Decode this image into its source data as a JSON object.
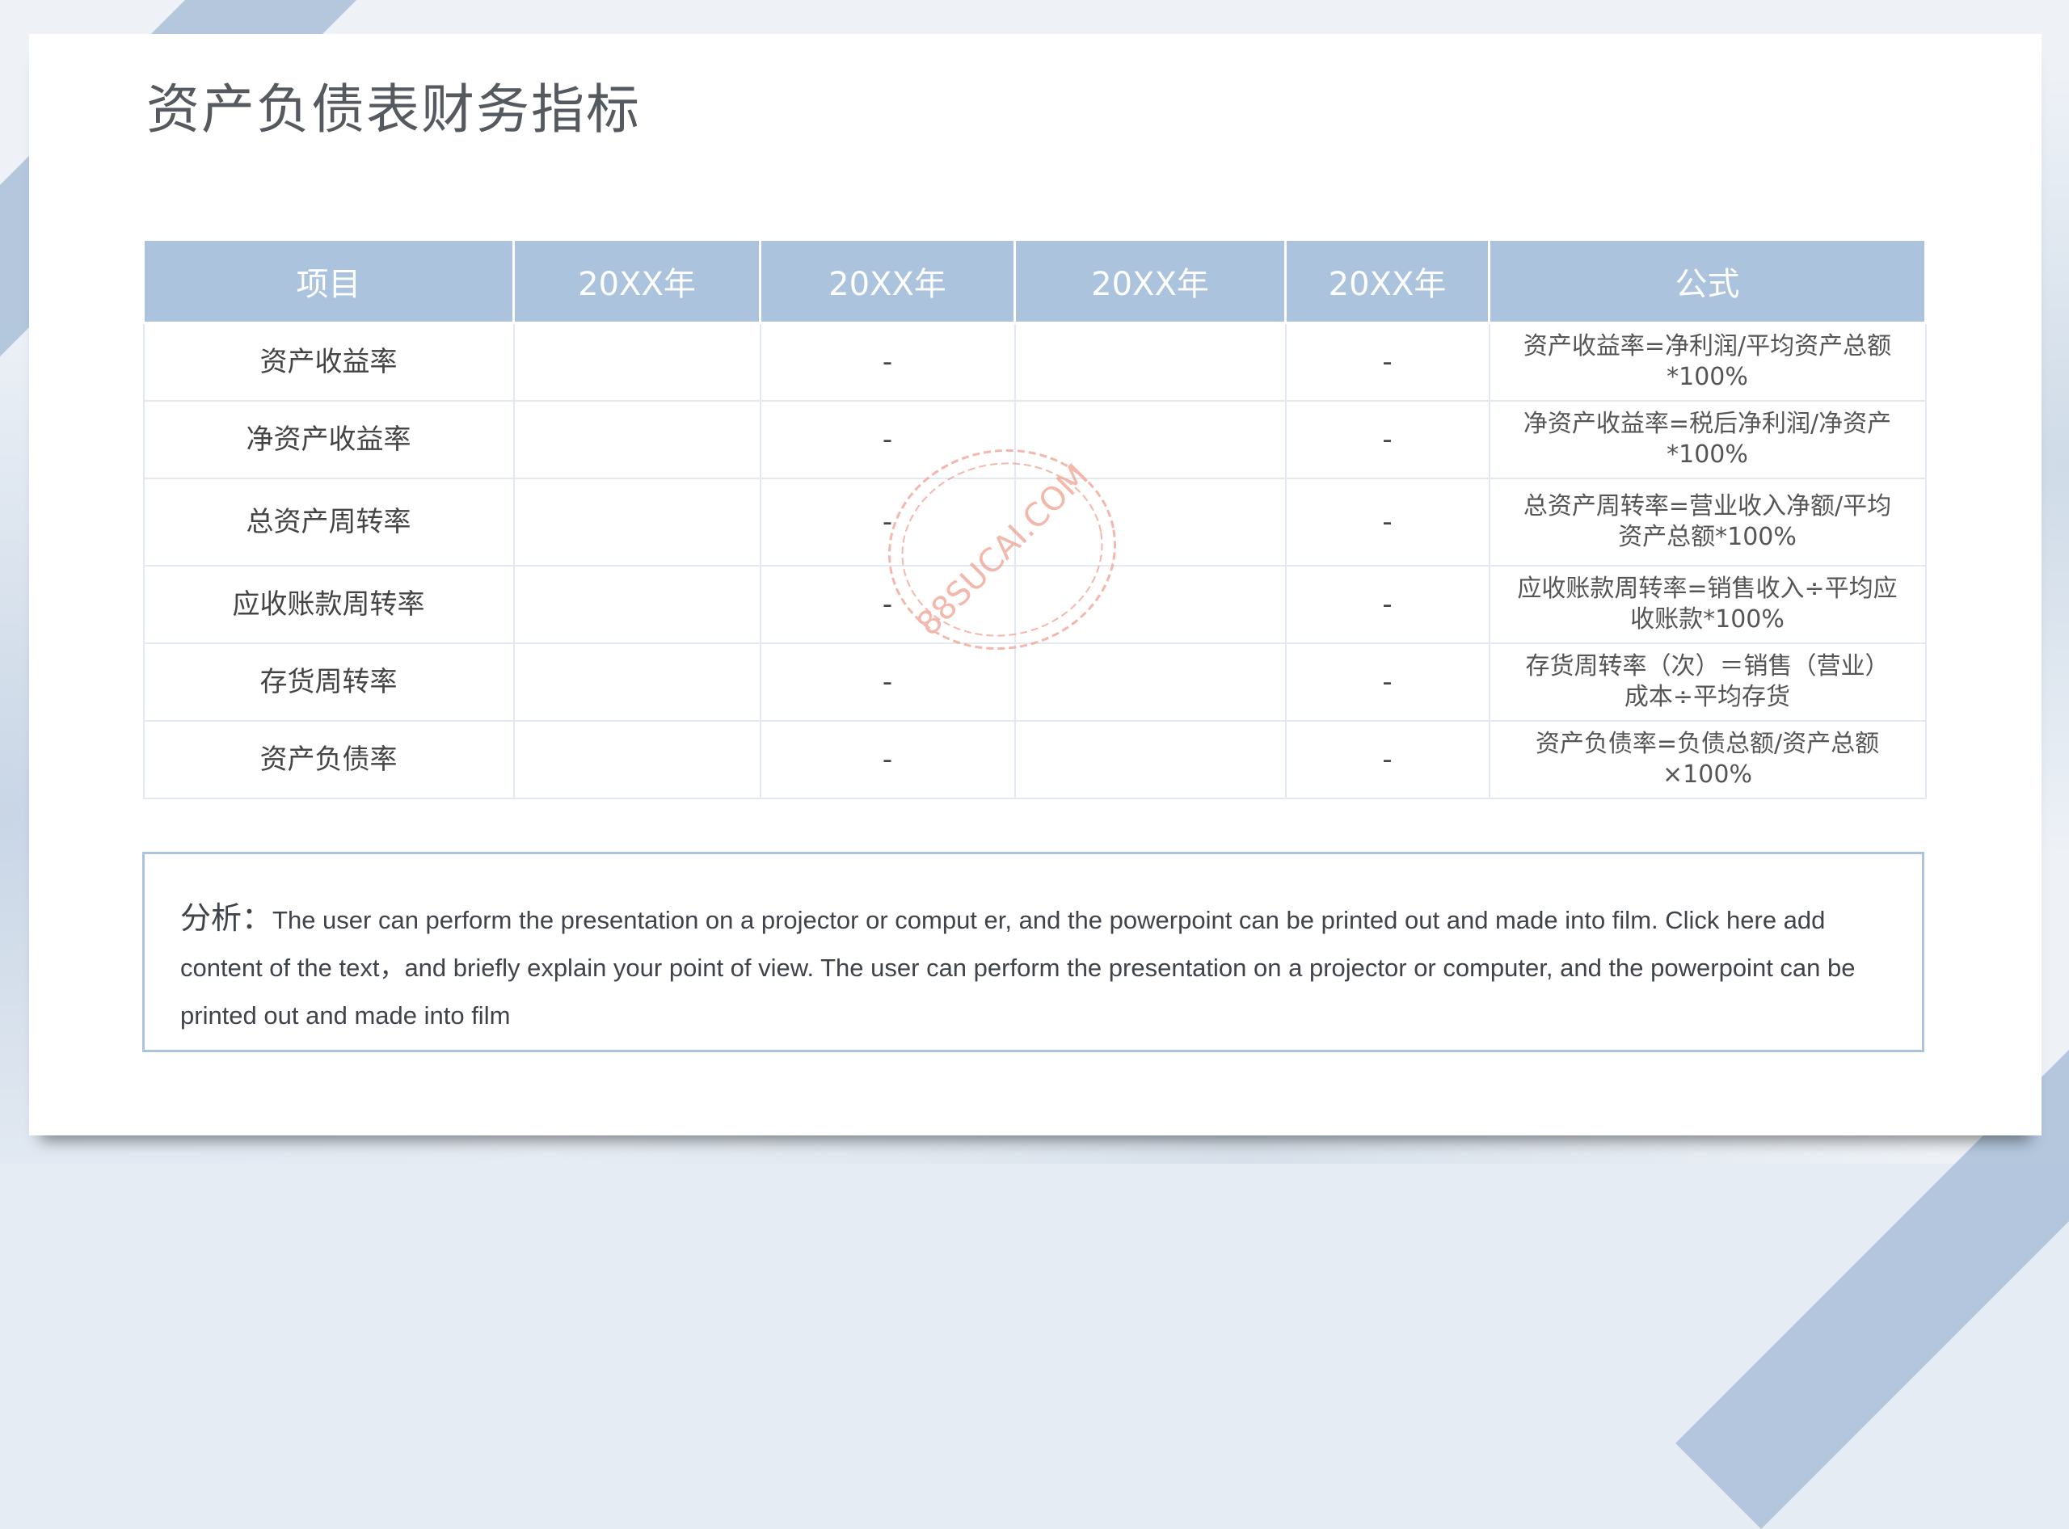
{
  "title": "资产负债表财务指标",
  "table": {
    "headers": [
      "项目",
      "20XX年",
      "20XX年",
      "20XX年",
      "20XX年",
      "公式"
    ],
    "rows": [
      {
        "item": "资产收益率",
        "y1": "",
        "y2": "-",
        "y3": "",
        "y4": "-",
        "formula_1": "资产收益率=净利润/平均资产总额",
        "formula_2": "*100%"
      },
      {
        "item": "净资产收益率",
        "y1": "",
        "y2": "-",
        "y3": "",
        "y4": "-",
        "formula_1": "净资产收益率=税后净利润/净资产",
        "formula_2": "*100%"
      },
      {
        "item": "总资产周转率",
        "y1": "",
        "y2": "-",
        "y3": "",
        "y4": "-",
        "formula_1": "总资产周转率=营业收入净额/平均",
        "formula_2": "资产总额*100%"
      },
      {
        "item": "应收账款周转率",
        "y1": "",
        "y2": "-",
        "y3": "",
        "y4": "-",
        "formula_1": "应收账款周转率=销售收入÷平均应",
        "formula_2": "收账款*100%"
      },
      {
        "item": "存货周转率",
        "y1": "",
        "y2": "-",
        "y3": "",
        "y4": "-",
        "formula_1": "存货周转率（次）＝销售（营业）",
        "formula_2": "成本÷平均存货"
      },
      {
        "item": "资产负债率",
        "y1": "",
        "y2": "-",
        "y3": "",
        "y4": "-",
        "formula_1": "资产负债率=负债总额/资产总额",
        "formula_2": "×100%"
      }
    ]
  },
  "analysis": {
    "label": "分析：",
    "text": "The user can perform the presentation on a projector or comput er, and the powerpoint can be printed out and made into film. Click here add content of the text，and briefly explain your point of view. The user can perform the presentation on a projector or computer, and the powerpoint can be printed out and made into film"
  },
  "watermark": {
    "text": "88SUCAI.COM",
    "color": "#f0a090"
  },
  "colors": {
    "header": "#abc3dc",
    "accent": "#a9bfd8"
  }
}
